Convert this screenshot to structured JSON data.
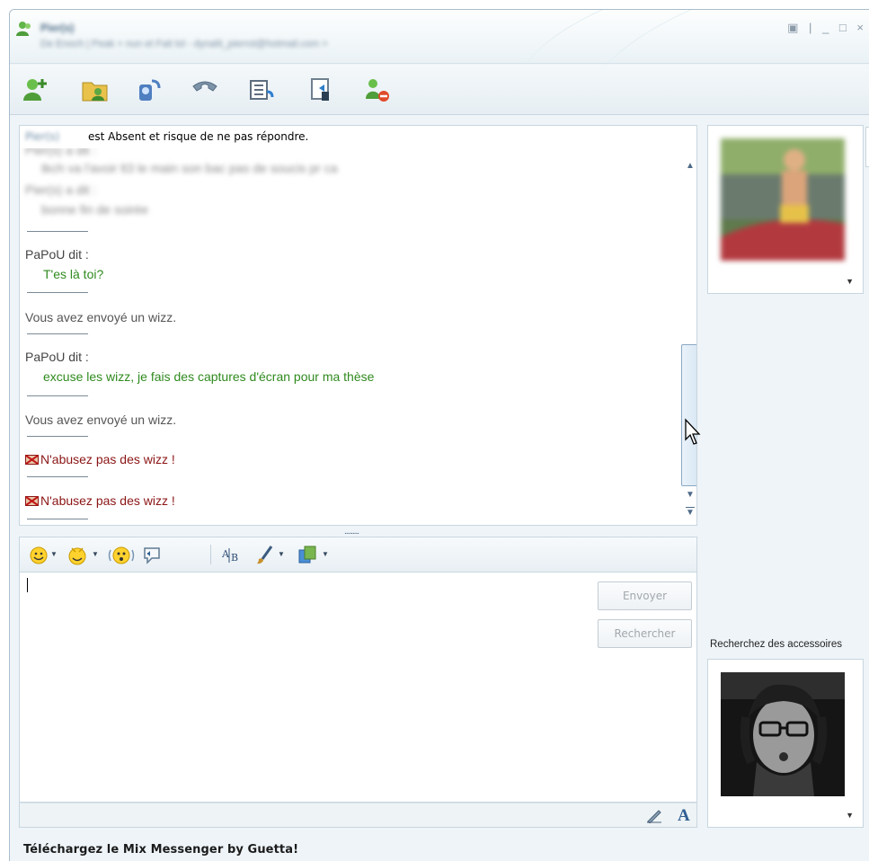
{
  "window": {
    "title": "Pier(s)",
    "subtitle": "De Enoch | Peak + nun et Fait lol - dynalit_pierrot@hotmail.com >",
    "controls": [
      "▣",
      "|",
      "_",
      "□",
      "×"
    ]
  },
  "toolbar": {
    "items": [
      {
        "name": "invite-contact",
        "icon": "add-contact-icon"
      },
      {
        "name": "send-files",
        "icon": "share-files-icon"
      },
      {
        "name": "video-call",
        "icon": "webcam-call-icon"
      },
      {
        "name": "call",
        "icon": "phone-icon"
      },
      {
        "name": "activities",
        "icon": "activities-icon"
      },
      {
        "name": "games",
        "icon": "games-icon"
      },
      {
        "name": "block",
        "icon": "block-contact-icon"
      }
    ]
  },
  "conversation": {
    "banner_contact": "Pier(s)",
    "banner_status": "est Absent et risque de ne pas répondre.",
    "blurred_lines": [
      "Pier(s) a dit :",
      "tkch va l'avoir lt3 le main son bac pas de soucis pr ca",
      "Pier(s) a dit :",
      "bonne fin de soirée"
    ],
    "messages": [
      {
        "sender": "PaPoU dit :",
        "text": "T'es là toi?"
      },
      {
        "system": "Vous avez envoyé un wizz."
      },
      {
        "sender": "PaPoU dit :",
        "text": "excuse les wizz, je fais des captures d'écran pour ma thèse"
      },
      {
        "system": "Vous avez envoyé un wizz."
      },
      {
        "warning": "N'abusez pas des wizz !"
      },
      {
        "warning": "N'abusez pas des wizz !"
      }
    ],
    "splitter": "........."
  },
  "format_bar": {
    "items": [
      "emoticon-icon",
      "wink-icon",
      "nudge-icon",
      "voice-clip-icon",
      "spellcheck-icon",
      "background-icon",
      "paste-icon"
    ]
  },
  "compose": {
    "send_label": "Envoyer",
    "search_label": "Rechercher",
    "footer_font_label": "A"
  },
  "sidebar": {
    "accessories_label": "Recherchez des accessoires"
  },
  "bottom": {
    "link": "Téléchargez le Mix Messenger by Guetta!"
  },
  "colors": {
    "accent": "#2f8a1e",
    "warning": "#8b1515",
    "border": "#c9d6df"
  }
}
